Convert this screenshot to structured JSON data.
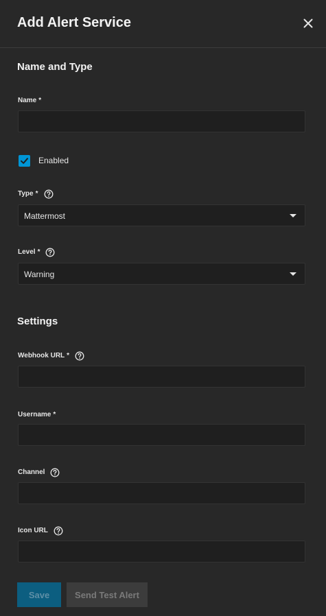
{
  "dialog": {
    "title": "Add Alert Service",
    "close_icon": "close-icon"
  },
  "name_and_type": {
    "heading": "Name and Type",
    "name": {
      "label": "Name",
      "required_mark": "*",
      "value": ""
    },
    "enabled": {
      "label": "Enabled",
      "checked": true
    },
    "type": {
      "label": "Type",
      "required_mark": "*",
      "value": "Mattermost",
      "help_icon": "help-circle-icon"
    },
    "level": {
      "label": "Level",
      "required_mark": "*",
      "value": "Warning",
      "help_icon": "help-circle-icon"
    }
  },
  "settings": {
    "heading": "Settings",
    "webhook_url": {
      "label": "Webhook URL",
      "required_mark": "*",
      "value": "",
      "help_icon": "help-circle-icon"
    },
    "username": {
      "label": "Username",
      "required_mark": "*",
      "value": ""
    },
    "channel": {
      "label": "Channel",
      "value": "",
      "help_icon": "help-circle-icon"
    },
    "icon_url": {
      "label": "Icon URL",
      "value": "",
      "help_icon": "help-circle-icon"
    }
  },
  "actions": {
    "save_label": "Save",
    "send_test_label": "Send Test Alert"
  },
  "colors": {
    "background": "#282828",
    "input_background": "#1f1f1f",
    "accent": "#0095d5",
    "save_disabled": "#0c5e80",
    "secondary_disabled": "#3c3c3c"
  }
}
